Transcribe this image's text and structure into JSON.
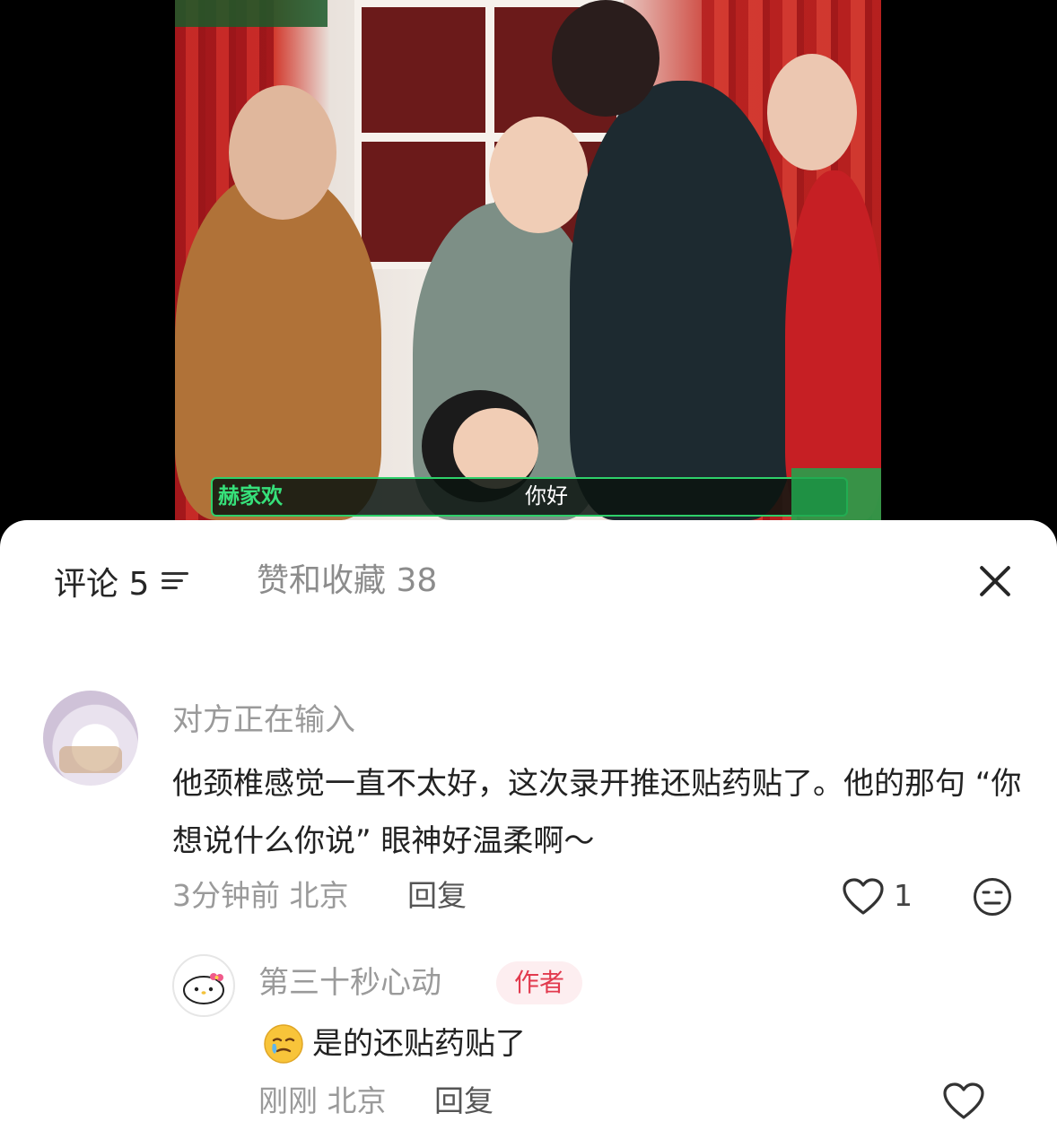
{
  "video": {
    "speaker_caption": "赫家欢",
    "subtitle": "你好"
  },
  "tabs": {
    "comments_label": "评论 5",
    "likes_label": "赞和收藏 38"
  },
  "comment": {
    "author": "对方正在输入",
    "text": "他颈椎感觉一直不太好，这次录开推还贴药贴了。他的那句 “你想说什么你说” 眼神好温柔啊～",
    "meta": "3分钟前 北京",
    "reply_label": "回复",
    "like_count": "1"
  },
  "reply": {
    "author": "第三十秒心动",
    "badge": "作者",
    "text": "是的还贴药贴了",
    "meta": "刚刚 北京",
    "reply_label": "回复"
  },
  "icons": {
    "sort": "sort-icon",
    "close": "close-icon",
    "like": "heart-outline-icon",
    "dislike": "meh-face-icon",
    "emoji": "tearful-smile-emoji"
  }
}
